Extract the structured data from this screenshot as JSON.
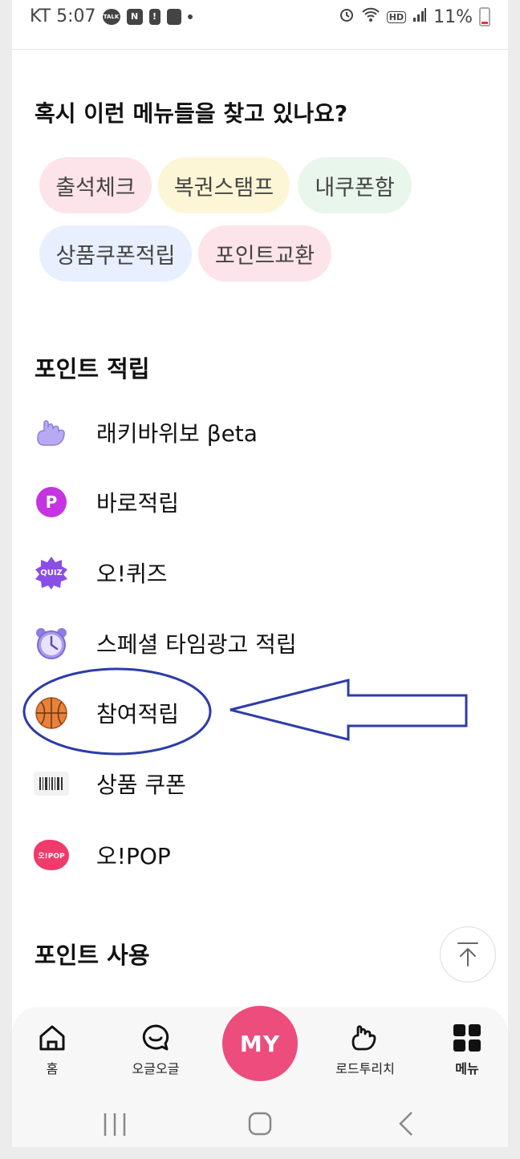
{
  "status_bar": {
    "carrier_time": "KT 5:07",
    "battery": "11%",
    "talk_badge": "TALK",
    "n_badge": "N",
    "hd_badge": "HD"
  },
  "suggest": {
    "title": "혹시 이런 메뉴들을 찾고 있나요?",
    "chips": [
      {
        "label": "출석체크",
        "bg": "#fde3ea"
      },
      {
        "label": "복권스탬프",
        "bg": "#fdf6d6"
      },
      {
        "label": "내쿠폰함",
        "bg": "#e9f6ec"
      },
      {
        "label": "상품쿠폰적립",
        "bg": "#e8efff"
      },
      {
        "label": "포인트교환",
        "bg": "#fde3ea"
      }
    ]
  },
  "earn": {
    "title": "포인트 적립",
    "items": [
      {
        "label": "래키바위보 βeta",
        "icon": "hand-icon"
      },
      {
        "label": "바로적립",
        "icon": "p-coin-icon",
        "icon_text": "P"
      },
      {
        "label": "오!퀴즈",
        "icon": "quiz-badge-icon",
        "icon_text": "QUIZ"
      },
      {
        "label": "스페셜 타임광고 적립",
        "icon": "alarm-clock-icon"
      },
      {
        "label": "참여적립",
        "icon": "basketball-icon"
      },
      {
        "label": "상품 쿠폰",
        "icon": "barcode-icon"
      },
      {
        "label": "오!POP",
        "icon": "opop-logo-icon",
        "icon_text": "오!POP"
      }
    ]
  },
  "use": {
    "title": "포인트 사용"
  },
  "bottom_tabs": [
    {
      "label": "홈",
      "icon": "home-icon"
    },
    {
      "label": "오글오글",
      "icon": "chat-smile-icon"
    },
    {
      "label": "MY",
      "icon": "my-button"
    },
    {
      "label": "로드투리치",
      "icon": "hand-icon"
    },
    {
      "label": "메뉴",
      "icon": "grid-menu-icon"
    }
  ],
  "colors": {
    "accent": "#ec4d7d",
    "annotation": "#2c3ca8",
    "p_coin": "#c534e0",
    "quiz": "#8a4ee6"
  }
}
